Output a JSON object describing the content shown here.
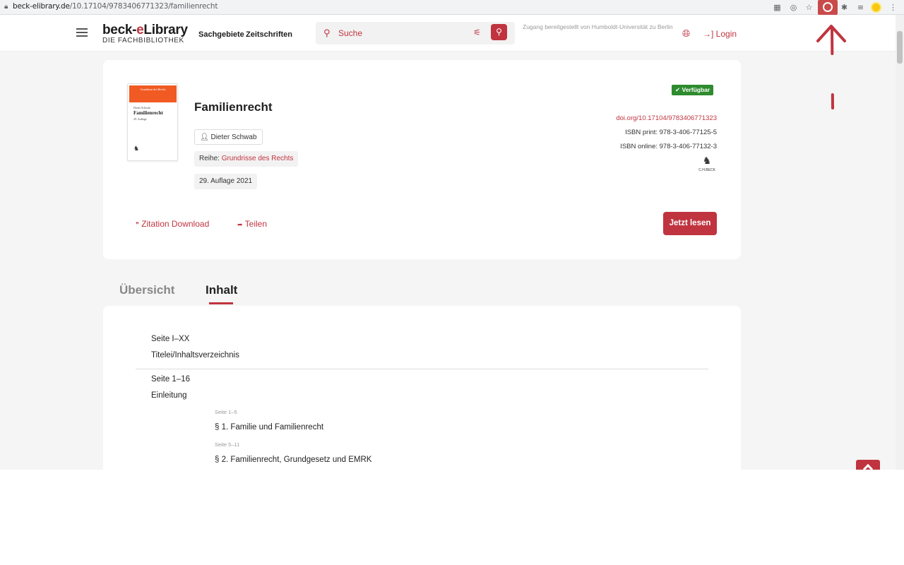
{
  "browser": {
    "url_host": "beck-elibrary.de",
    "url_path": "/10.17104/9783406771323/familienrecht",
    "colors": {
      "bar": "#f1f3f4",
      "active_extension": "#c94a4a"
    }
  },
  "header": {
    "brand_name_prefix": "beck-",
    "brand_name_e": "e",
    "brand_name_suffix": "Library",
    "brand_sub": "DIE FACHBIBLIOTHEK",
    "nav": [
      "Sachgebiete",
      "Zeitschriften"
    ],
    "search_placeholder": "Suche",
    "access_note": "Zugang bereitgestellt von Humboldt-Universität zu Berlin",
    "login_label": "Login"
  },
  "book": {
    "title": "Familienrecht",
    "author": "Dieter Schwab",
    "series_label": "Reihe:",
    "series_name": "Grundrisse des Rechts",
    "edition": "29. Auflage 2021",
    "availability": "Verfügbar",
    "doi": "doi.org/10.17104/9783406771323",
    "isbn_print": "ISBN print: 978-3-406-77125-5",
    "isbn_online": "ISBN online: 978-3-406-77132-3",
    "publisher_logo_text": "C.H.BECK",
    "cover": {
      "series": "Grundrisse des Rechts",
      "author": "Dieter Schwab",
      "title": "Familienrecht",
      "edition": "29. Auflage"
    },
    "actions": {
      "citation": "Zitation Download",
      "share": "Teilen",
      "read": "Jetzt lesen"
    }
  },
  "tabs": [
    {
      "label": "Übersicht",
      "active": false
    },
    {
      "label": "Inhalt",
      "active": true
    }
  ],
  "toc": [
    {
      "pages": "Seite I–XX",
      "title": "Titelei/Inhaltsverzeichnis"
    },
    {
      "pages": "Seite 1–16",
      "title": "Einleitung",
      "children": [
        {
          "pages": "Seite 1–5",
          "title": "§ 1. Familie und Familienrecht"
        },
        {
          "pages": "Seite 5–11",
          "title": "§ 2. Familienrecht, Grundgesetz und EMRK"
        }
      ]
    }
  ],
  "colors": {
    "accent": "#c0343f",
    "available": "#2e8b2e",
    "background": "#f5f5f5"
  }
}
